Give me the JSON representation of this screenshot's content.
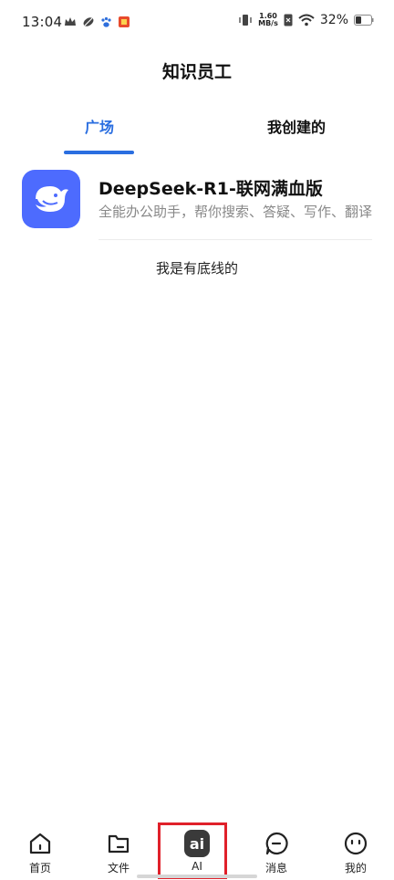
{
  "status_bar": {
    "time": "13:04",
    "speed_value": "1.60",
    "speed_unit": "MB/s",
    "battery": "32%"
  },
  "header": {
    "title": "知识员工"
  },
  "tabs": [
    {
      "label": "广场",
      "active": true
    },
    {
      "label": "我创建的",
      "active": false
    }
  ],
  "bot": {
    "name": "DeepSeek-R1-联网满血版",
    "description": "全能办公助手，帮你搜索、答疑、写作、翻译",
    "avatar_icon": "deepseek-whale-icon",
    "avatar_color": "#4d6bfe"
  },
  "footer_note": "我是有底线的",
  "bottom_nav": [
    {
      "label": "首页",
      "icon": "home-icon"
    },
    {
      "label": "文件",
      "icon": "folder-icon"
    },
    {
      "label": "AI",
      "icon": "ai-icon",
      "highlighted": true
    },
    {
      "label": "消息",
      "icon": "message-icon"
    },
    {
      "label": "我的",
      "icon": "profile-icon"
    }
  ],
  "colors": {
    "accent": "#2a6ee0",
    "highlight_box": "#e0202a"
  }
}
